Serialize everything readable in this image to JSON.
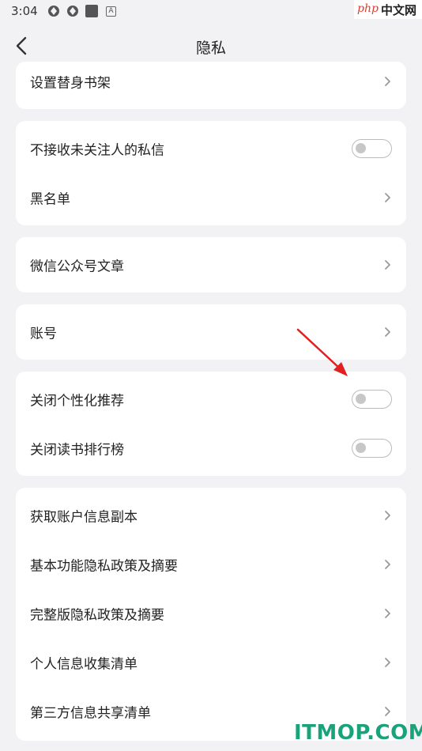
{
  "status_bar": {
    "time": "3:04",
    "a_badge": "A"
  },
  "watermark": {
    "top_php": "php",
    "top_cn": "中文网",
    "bottom": "ITMOP.COM"
  },
  "header": {
    "title": "隐私"
  },
  "groups": [
    {
      "items": [
        {
          "label": "设置替身书架",
          "control": "chevron"
        }
      ]
    },
    {
      "items": [
        {
          "label": "不接收未关注人的私信",
          "control": "toggle",
          "on": false
        },
        {
          "label": "黑名单",
          "control": "chevron"
        }
      ]
    },
    {
      "items": [
        {
          "label": "微信公众号文章",
          "control": "chevron"
        }
      ]
    },
    {
      "items": [
        {
          "label": "账号",
          "control": "chevron"
        }
      ]
    },
    {
      "items": [
        {
          "label": "关闭个性化推荐",
          "control": "toggle",
          "on": false
        },
        {
          "label": "关闭读书排行榜",
          "control": "toggle",
          "on": false
        }
      ]
    },
    {
      "items": [
        {
          "label": "获取账户信息副本",
          "control": "chevron"
        },
        {
          "label": "基本功能隐私政策及摘要",
          "control": "chevron"
        },
        {
          "label": "完整版隐私政策及摘要",
          "control": "chevron"
        },
        {
          "label": "个人信息收集清单",
          "control": "chevron"
        },
        {
          "label": "第三方信息共享清单",
          "control": "chevron"
        }
      ]
    }
  ],
  "colors": {
    "background": "#f2f2f4",
    "card": "#ffffff",
    "annotation_arrow": "#e02020",
    "watermark_green": "#1aa37a"
  }
}
